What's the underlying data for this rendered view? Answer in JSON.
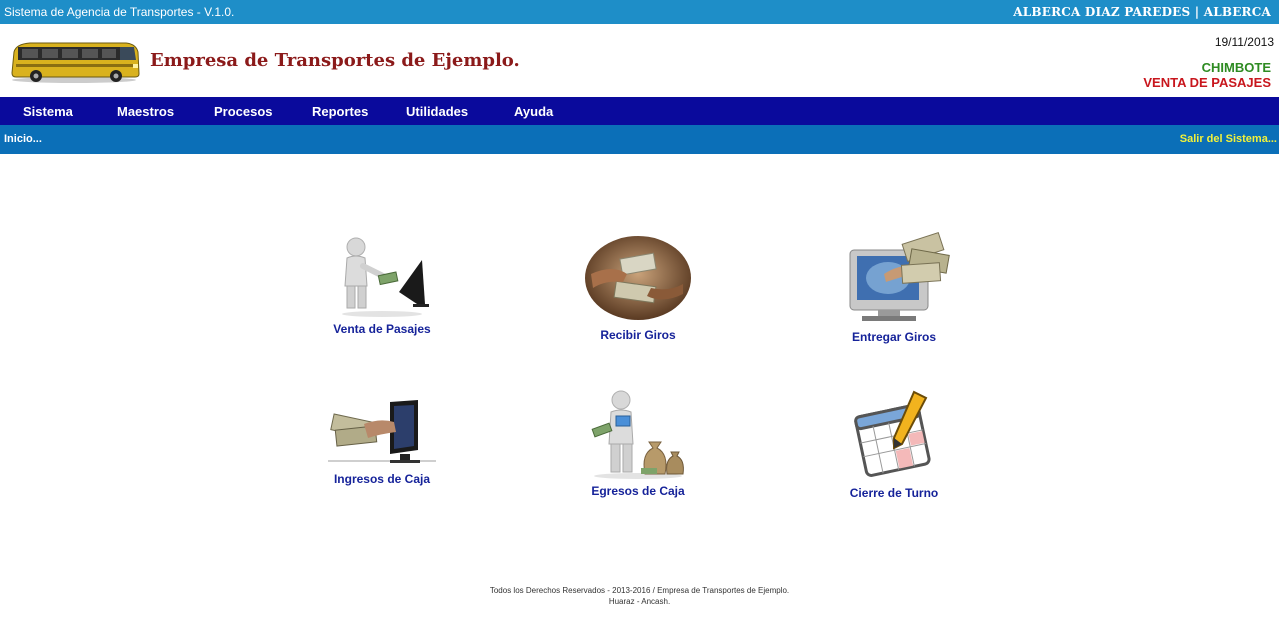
{
  "topbar": {
    "system_title": "Sistema de Agencia de Transportes - V.1.0.",
    "user": "ALBERCA DIAZ PAREDES | ALBERCA"
  },
  "header": {
    "logo_icon": "bus-icon",
    "company_name": "Empresa de Transportes de Ejemplo.",
    "date": "19/11/2013",
    "city": "CHIMBOTE",
    "module": "VENTA DE PASAJES"
  },
  "menu": {
    "items": [
      {
        "label": "Sistema"
      },
      {
        "label": "Maestros"
      },
      {
        "label": "Procesos"
      },
      {
        "label": "Reportes"
      },
      {
        "label": "Utilidades"
      },
      {
        "label": "Ayuda"
      }
    ]
  },
  "subbar": {
    "home_link": "Inicio...",
    "logout_link": "Salir del Sistema..."
  },
  "shortcuts": [
    {
      "label": "Venta de Pasajes",
      "icon": "person-paying-computer-icon"
    },
    {
      "label": "Recibir Giros",
      "icon": "hands-money-icon"
    },
    {
      "label": "Entregar Giros",
      "icon": "monitor-money-icon"
    },
    {
      "label": "Ingresos de Caja",
      "icon": "money-into-monitor-icon"
    },
    {
      "label": "Egresos de Caja",
      "icon": "person-money-bags-icon"
    },
    {
      "label": "Cierre de Turno",
      "icon": "calendar-pencil-icon"
    }
  ],
  "footer": {
    "line1": "Todos los Derechos Reservados - 2013-2016 / Empresa de Transportes de Ejemplo.",
    "line2": "Huaraz - Ancash."
  },
  "colors": {
    "topbar": "#1e8ec8",
    "menubar": "#0a0a9c",
    "subbar": "#0b6fb8",
    "company": "#8b1a1a",
    "city": "#2e8b22",
    "module": "#c8161d",
    "tile_label": "#16239a"
  }
}
